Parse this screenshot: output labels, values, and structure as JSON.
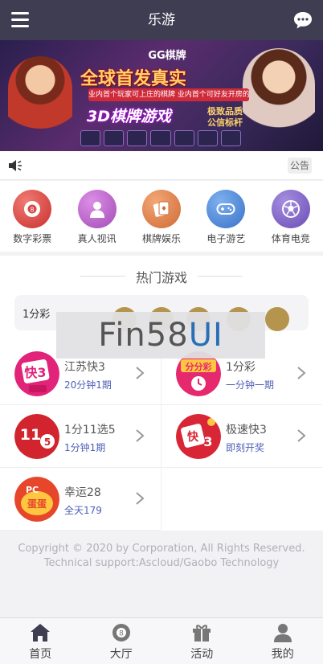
{
  "header": {
    "title": "乐游"
  },
  "banner": {
    "brand": "GG棋牌",
    "headline": "全球首发真实",
    "ribbon": "业内首个玩家可上庄的棋牌 业内首个可好友开房的棋牌",
    "subtitle": "3D棋牌游戏",
    "tagline_1": "极致品质",
    "tagline_2": "公信标杆"
  },
  "notice": {
    "button_label": "公告"
  },
  "categories": [
    {
      "label": "数字彩票",
      "icon": "lottery-ball-icon",
      "color": "#d94646"
    },
    {
      "label": "真人视讯",
      "icon": "person-icon",
      "color": "#b65cc8"
    },
    {
      "label": "棋牌娱乐",
      "icon": "cards-icon",
      "color": "#e07d45"
    },
    {
      "label": "电子游艺",
      "icon": "gamepad-icon",
      "color": "#4a86d8"
    },
    {
      "label": "体育电竞",
      "icon": "soccer-ball-icon",
      "color": "#7b5fc4"
    }
  ],
  "hot": {
    "title": "热门游戏",
    "lottery_name": "1分彩"
  },
  "games": [
    {
      "name": "江苏快3",
      "sub": "20分钟1期",
      "icon_text": "快3",
      "icon_color": "#e2237a"
    },
    {
      "name": "1分彩",
      "sub": "一分钟一期",
      "icon_text": "分分彩",
      "icon_color": "#e6286e"
    },
    {
      "name": "1分11选5",
      "sub": "1分钟1期",
      "icon_text": "11 5",
      "icon_color": "#d2242e"
    },
    {
      "name": "极速快3",
      "sub": "即刻开奖",
      "icon_text": "快3",
      "icon_color": "#d92636"
    },
    {
      "name": "幸运28",
      "sub": "全天179",
      "icon_text": "PC蛋蛋",
      "icon_color": "#e6462a"
    }
  ],
  "watermark": {
    "text_a": "Fin58",
    "text_b": "UI"
  },
  "footer": {
    "copyright": "Copyright © 2020 by Corporation, All Rights Reserved.",
    "support": "Technical support:Ascloud/Gaobo Technology"
  },
  "tabs": [
    {
      "label": "首页",
      "icon": "home-icon"
    },
    {
      "label": "大厅",
      "icon": "lobby-ball-icon"
    },
    {
      "label": "活动",
      "icon": "gift-icon"
    },
    {
      "label": "我的",
      "icon": "user-icon"
    }
  ]
}
